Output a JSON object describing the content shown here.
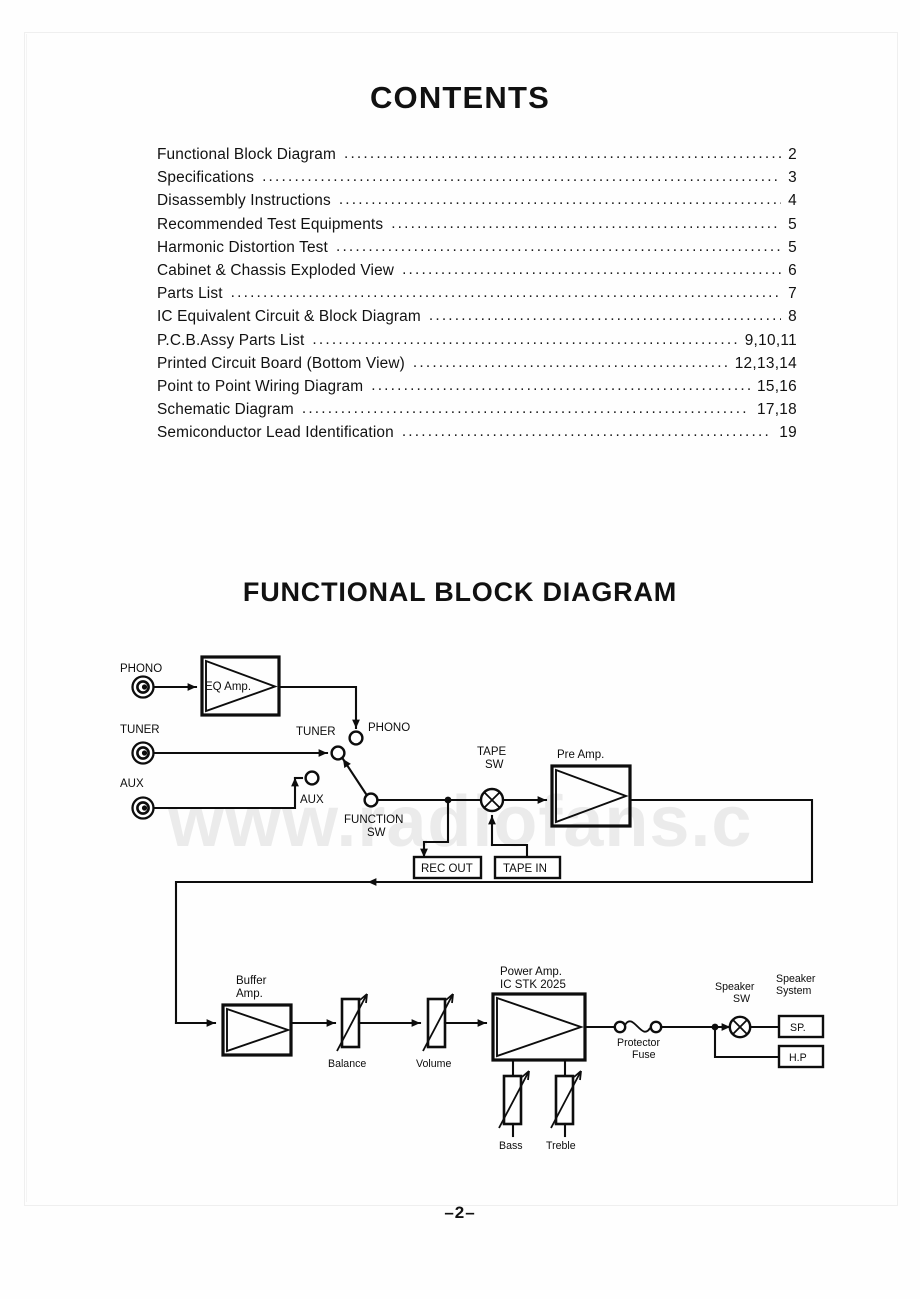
{
  "document": {
    "contents_title": "CONTENTS",
    "diagram_title": "FUNCTIONAL BLOCK DIAGRAM",
    "page_number": "–2–",
    "watermark": "www.radiofans.c"
  },
  "toc": {
    "leader": "...........................................................................................................................",
    "entries": [
      {
        "label": "Functional Block Diagram",
        "page": "2"
      },
      {
        "label": "Specifications",
        "page": "3"
      },
      {
        "label": "Disassembly Instructions",
        "page": "4"
      },
      {
        "label": "Recommended Test Equipments",
        "page": "5"
      },
      {
        "label": "Harmonic Distortion Test",
        "page": "5"
      },
      {
        "label": "Cabinet & Chassis Exploded View",
        "page": "6"
      },
      {
        "label": "Parts List",
        "page": "7"
      },
      {
        "label": "IC Equivalent Circuit & Block Diagram",
        "page": "8"
      },
      {
        "label": "P.C.B.Assy Parts List",
        "page": "9,10,11"
      },
      {
        "label": "Printed Circuit Board (Bottom View)",
        "page": "12,13,14"
      },
      {
        "label": "Point to Point Wiring Diagram",
        "page": "15,16"
      },
      {
        "label": "Schematic Diagram",
        "page": "17,18"
      },
      {
        "label": "Semiconductor Lead Identification",
        "page": "19"
      }
    ]
  },
  "diagram": {
    "inputs": [
      {
        "name": "phono-input-jack",
        "label": "PHONO"
      },
      {
        "name": "tuner-input-jack",
        "label": "TUNER"
      },
      {
        "name": "aux-input-jack",
        "label": "AUX"
      }
    ],
    "blocks": {
      "eq_amp": "EQ Amp.",
      "pre_amp": "Pre Amp.",
      "buffer_amp_line1": "Buffer",
      "buffer_amp_line2": "Amp.",
      "power_amp_line1": "Power Amp.",
      "power_amp_line2": "IC STK 2025"
    },
    "switch_nodes": {
      "phono": "PHONO",
      "tuner": "TUNER",
      "aux": "AUX",
      "function_sw_line1": "FUNCTION",
      "function_sw_line2": "SW",
      "tape_sw_line1": "TAPE",
      "tape_sw_line2": "SW",
      "speaker_sw_line1": "Speaker",
      "speaker_sw_line2": "SW"
    },
    "jacks": {
      "rec_out": "REC OUT",
      "tape_in": "TAPE IN"
    },
    "controls": {
      "balance": "Balance",
      "volume": "Volume",
      "bass": "Bass",
      "treble": "Treble"
    },
    "output": {
      "protector_line1": "Protector",
      "protector_line2": "Fuse",
      "speaker_system_line1": "Speaker",
      "speaker_system_line2": "System",
      "sp": "SP.",
      "hp": "H.P"
    }
  }
}
